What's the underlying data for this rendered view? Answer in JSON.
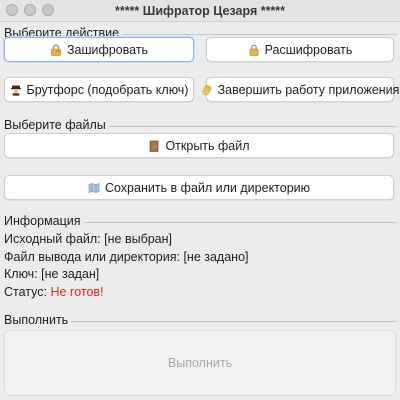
{
  "window": {
    "title": "***** Шифратор Цезаря *****"
  },
  "actions_section": {
    "title": "Выберите действие",
    "encrypt_button": {
      "label": "Зашифровать",
      "icon": "lock-key-icon"
    },
    "decrypt_button": {
      "label": "Расшифровать",
      "icon": "padlock-icon"
    },
    "bruteforce_button": {
      "label": "Брутфорс (подобрать ключ)",
      "icon": "detective-icon"
    },
    "exit_button": {
      "label": "Завершить работу приложения",
      "icon": "waving-hand-icon"
    }
  },
  "files_section": {
    "title": "Выберите файлы",
    "open_button": {
      "label": "Открыть файл",
      "icon": "door-icon"
    },
    "save_button": {
      "label": "Сохранить в файл или директорию",
      "icon": "map-icon"
    }
  },
  "info_section": {
    "title": "Информация",
    "source_file": {
      "label": "Исходный файл:",
      "value": "[не выбран]"
    },
    "output": {
      "label": "Файл вывода или директория:",
      "value": "[не задано]"
    },
    "key": {
      "label": "Ключ:",
      "value": "[не задан]"
    },
    "status": {
      "label": "Статус:",
      "value": "Не готов!",
      "color": "#e0271c"
    }
  },
  "execute_section": {
    "title": "Выполнить",
    "button": {
      "label": "Выполнить",
      "state": "disabled"
    }
  }
}
